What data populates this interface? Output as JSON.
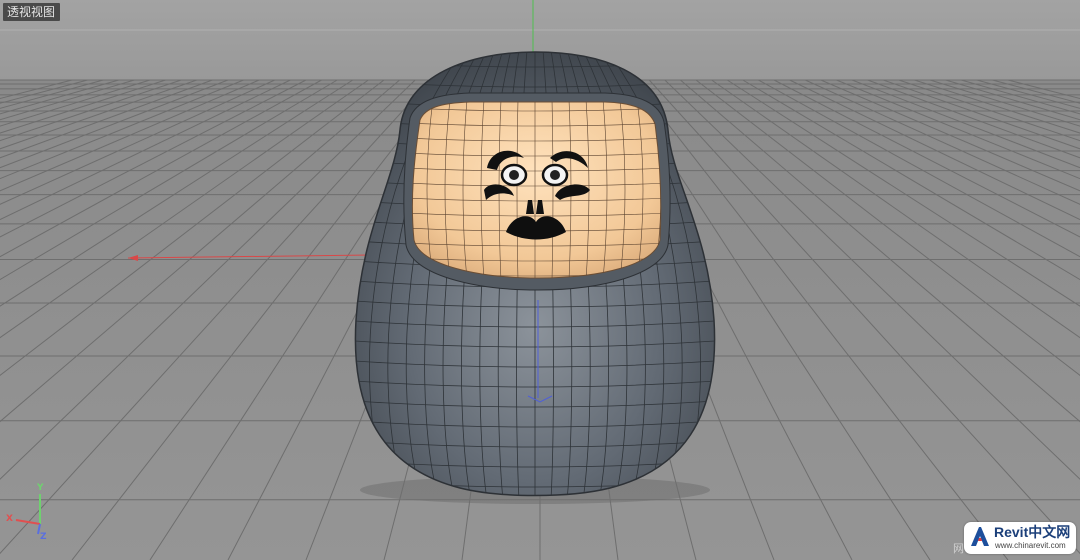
{
  "viewport": {
    "label": "透视视图",
    "background_top": "#9a9a9a",
    "background_floor": "#8c8c8c",
    "grid_color": "#6e6e6e"
  },
  "axis_gizmo": {
    "y_label": "Y",
    "x_label": "X",
    "z_label": "Z",
    "y_color": "#6fd16f",
    "x_color": "#e05050",
    "z_color": "#5a6fe0"
  },
  "model": {
    "body_color": "#5f6670",
    "face_color": "#f3cfa2"
  },
  "watermark": {
    "title": "Revit中文网",
    "url": "www.chinarevit.com",
    "edge_text": "网"
  }
}
